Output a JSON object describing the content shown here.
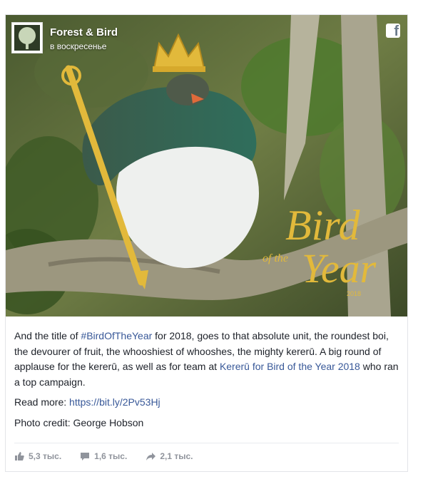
{
  "post": {
    "page_name": "Forest & Bird",
    "timestamp": "в воскресенье",
    "platform_icon": "facebook-icon",
    "overlay_title_1": "Bird",
    "overlay_title_2": "of the",
    "overlay_title_3": "Year",
    "overlay_year": "2018",
    "text_intro": "And the title of ",
    "hashtag": "#BirdOfTheYear",
    "text_mid": " for 2018, goes to that absolute unit, the roundest boi, the devourer of fruit, the whooshiest of whooshes, the mighty kererū. A big round of applause for the kererū, as well as for team at ",
    "campaign_link": "Kererū for Bird of the Year 2018",
    "text_end": " who ran a top campaign.",
    "read_more_label": "Read more: ",
    "read_more_url": "https://bit.ly/2Pv53Hj",
    "photo_credit": "Photo credit: George Hobson"
  },
  "stats": {
    "likes": "5,3 тыс.",
    "comments": "1,6 тыс.",
    "shares": "2,1 тыс."
  },
  "colors": {
    "link": "#385898",
    "text": "#1d2129",
    "muted": "#90949c",
    "gold": "#e2b93b"
  }
}
